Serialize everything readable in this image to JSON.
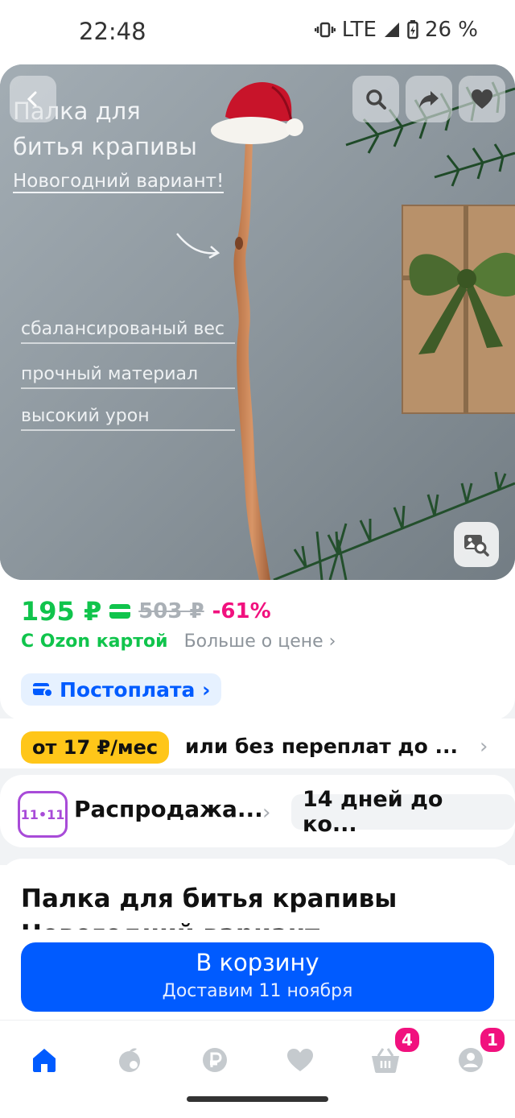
{
  "status_bar": {
    "time": "22:48",
    "network": "LTE",
    "battery": "26 %"
  },
  "hero": {
    "title_line1": "Палка для",
    "title_line2": "битья крапивы",
    "subtitle": "Новогодний вариант!",
    "features": [
      "сбалансированый вес",
      "прочный материал",
      "высокий урон"
    ]
  },
  "price": {
    "current": "195 ₽",
    "old": "503 ₽",
    "discount": "-61%",
    "card_label": "С Ozon картой",
    "more_label": "Больше о цене ›"
  },
  "postpay": {
    "label": "Постоплата ›"
  },
  "installment": {
    "badge": "от 17 ₽/мес",
    "text": "или без переплат до ..."
  },
  "sale": {
    "badge": "11•11",
    "title": "Распродажа...",
    "days": "14 дней до ко..."
  },
  "product": {
    "name": "Палка для битья крапивы Новогодний вариант"
  },
  "cart_button": {
    "label": "В корзину",
    "delivery": "Доставим 11 ноября"
  },
  "navbar": {
    "cart_count": "4",
    "profile_count": "1"
  },
  "colors": {
    "accent": "#005bff",
    "price_green": "#10c44c",
    "discount_pink": "#f1117e",
    "installment_yellow": "#ffc619"
  }
}
